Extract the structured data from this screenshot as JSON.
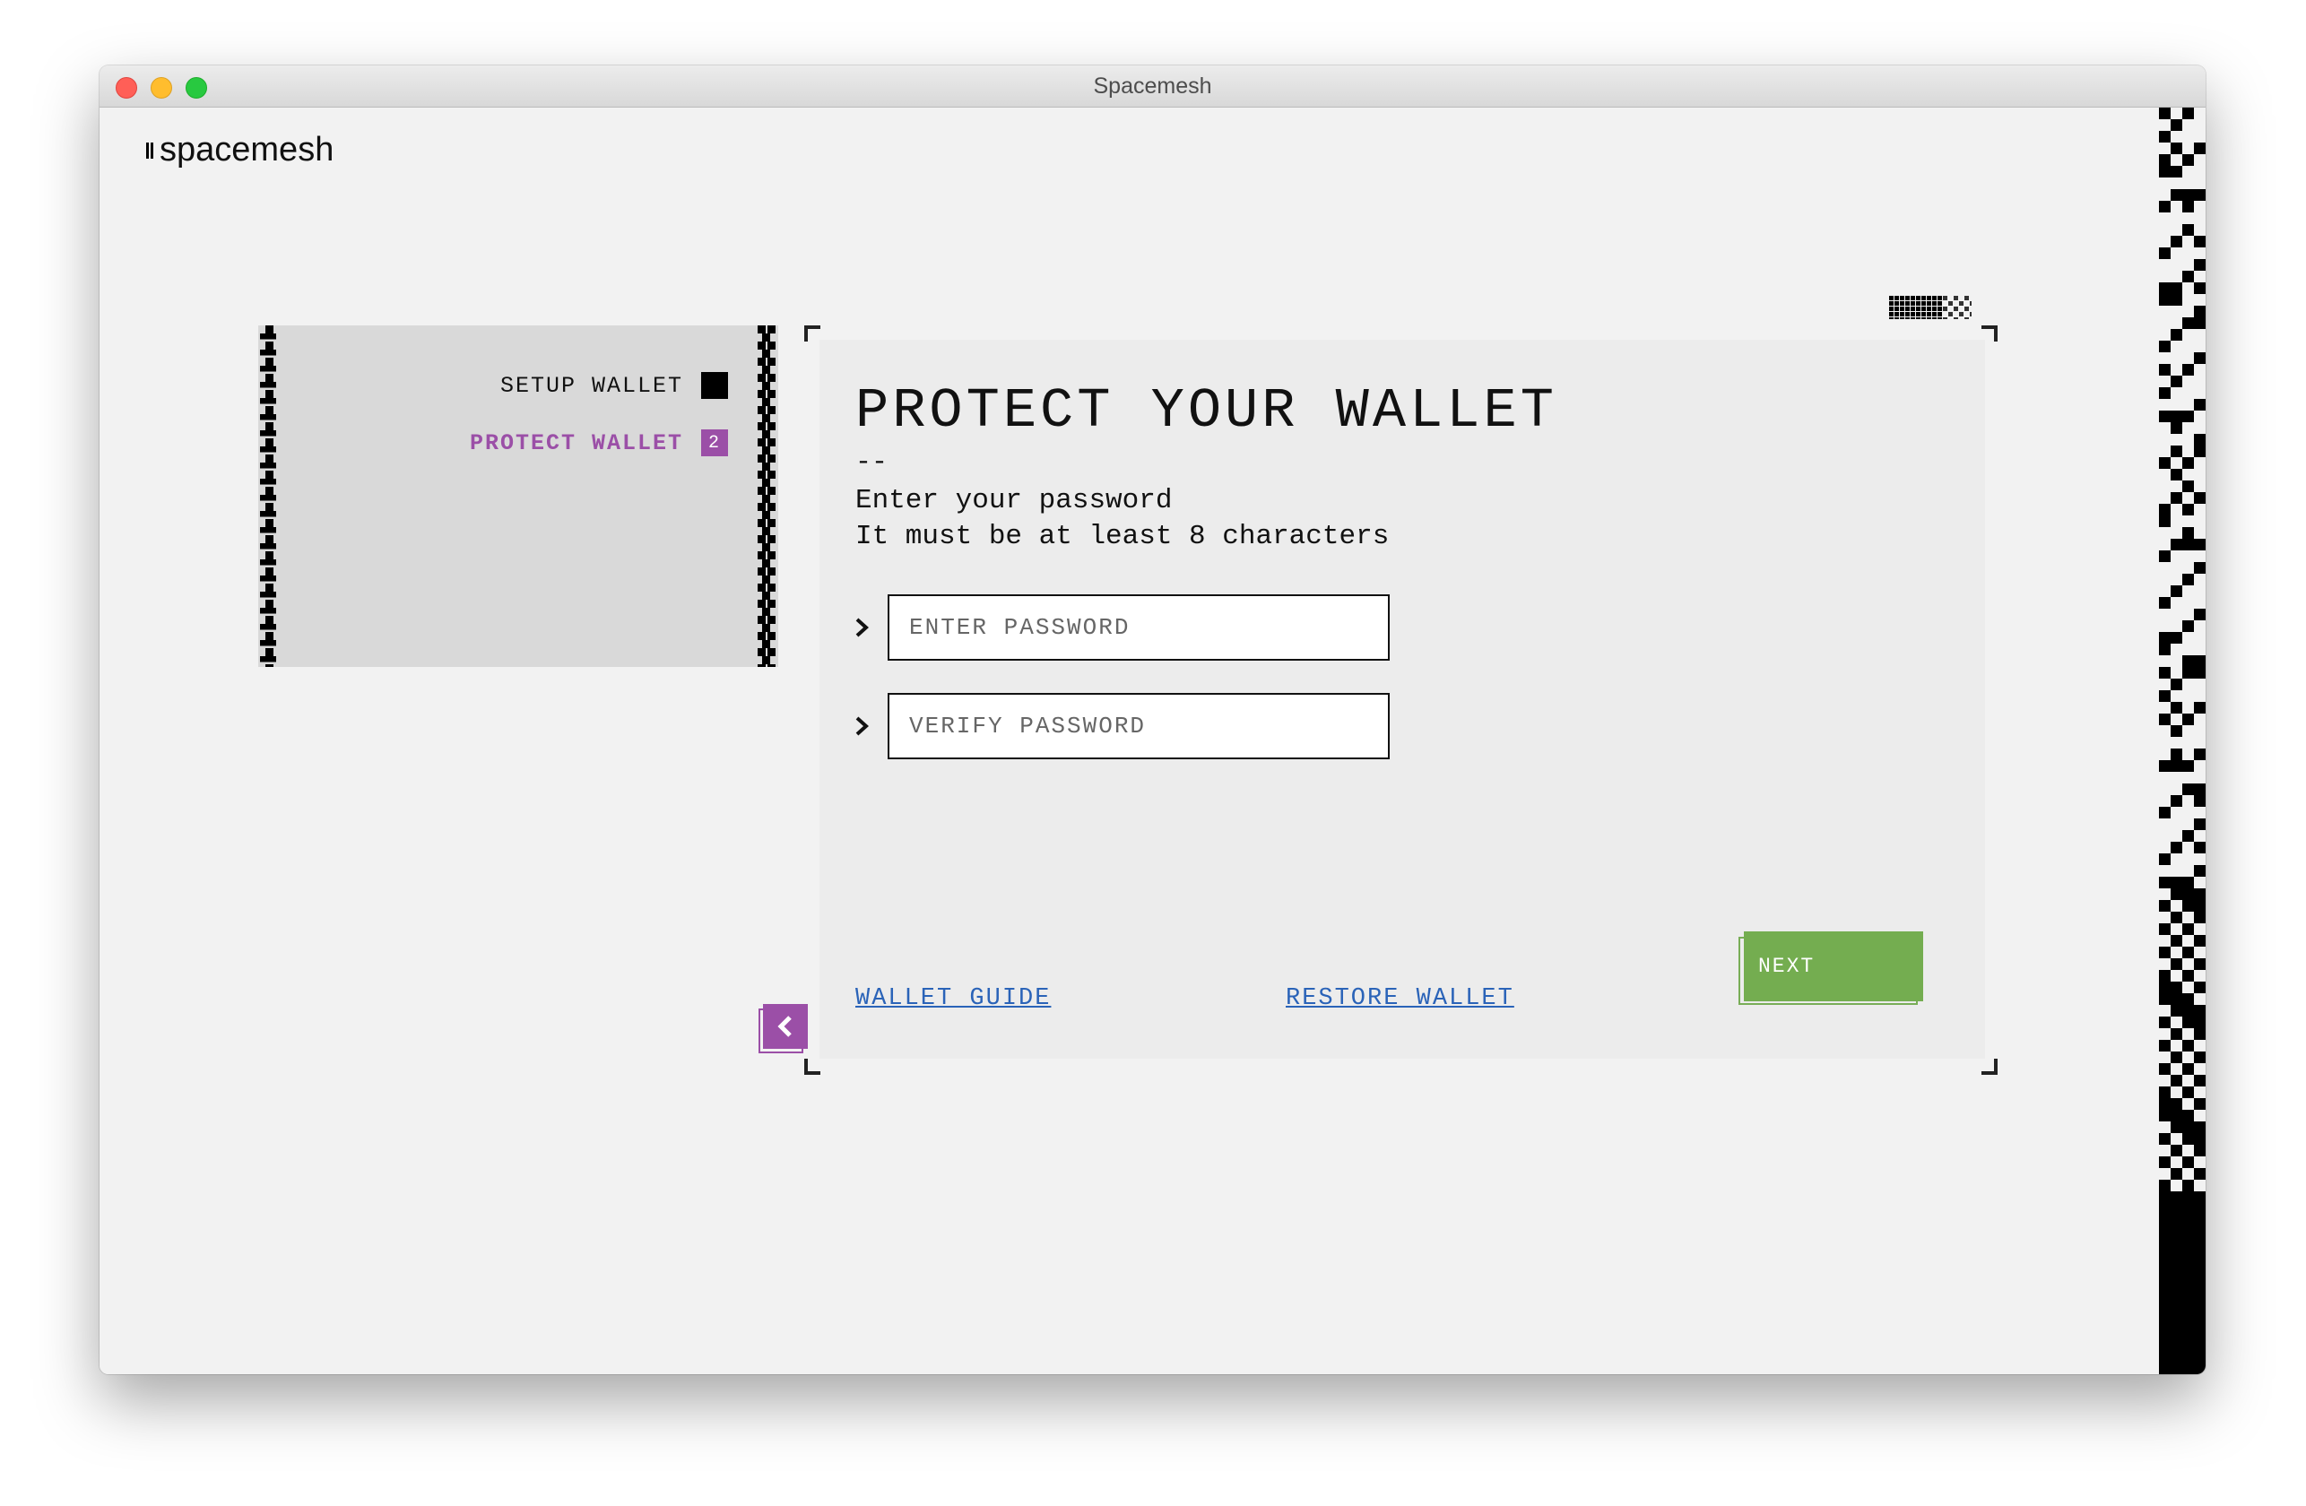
{
  "window": {
    "title": "Spacemesh"
  },
  "logo": {
    "text": "spacemesh"
  },
  "progress": {
    "steps": [
      {
        "label": "SETUP WALLET",
        "marker": ""
      },
      {
        "label": "PROTECT WALLET",
        "marker": "2"
      }
    ]
  },
  "card": {
    "title": "PROTECT YOUR WALLET",
    "dash": "--",
    "subtitle_line1": "Enter your password",
    "subtitle_line2": "It must be at least 8 characters",
    "password_placeholder": "ENTER PASSWORD",
    "password_value": "",
    "verify_placeholder": "VERIFY PASSWORD",
    "verify_value": "",
    "wallet_guide_link": "WALLET GUIDE",
    "restore_wallet_link": "RESTORE WALLET",
    "next_label": "NEXT"
  },
  "colors": {
    "accent_purple": "#9b4fa7",
    "next_green": "#74ad50",
    "link_blue": "#2a63b8",
    "background": "#f2f2f2"
  },
  "icons": [
    "back-chevron-icon",
    "field-chevron-icon",
    "logo-mark-icon"
  ]
}
